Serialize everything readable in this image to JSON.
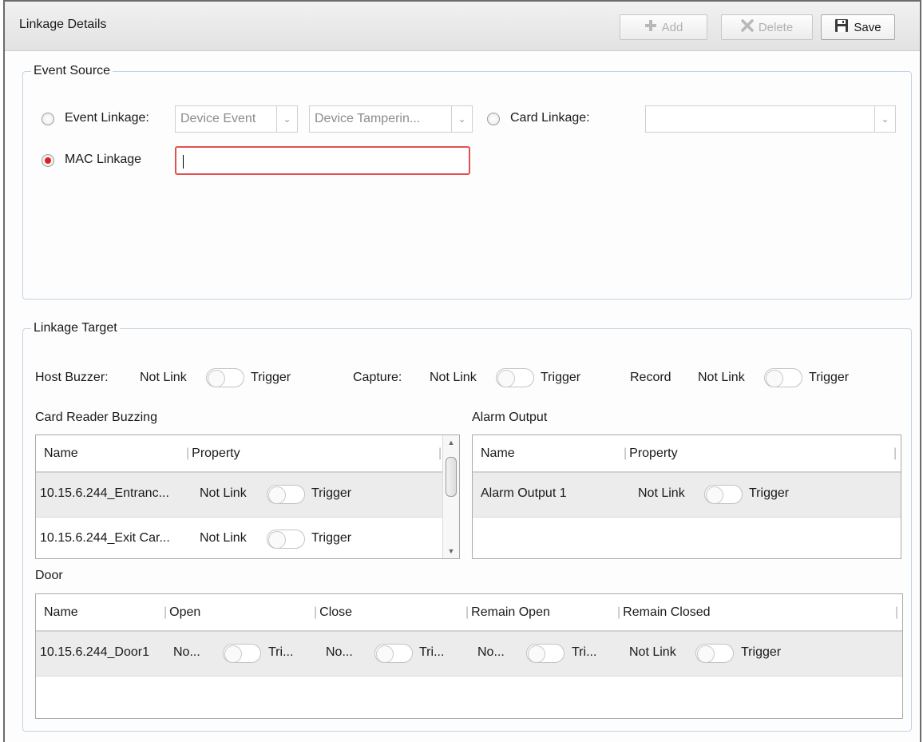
{
  "header": {
    "title": "Linkage Details",
    "add_label": "Add",
    "delete_label": "Delete",
    "save_label": "Save"
  },
  "event_source": {
    "legend": "Event Source",
    "event_linkage": {
      "label": "Event Linkage:",
      "selected": false,
      "category_value": "Device Event",
      "event_value": "Device Tamperin..."
    },
    "card_linkage": {
      "label": "Card Linkage:",
      "selected": false,
      "value": ""
    },
    "mac_linkage": {
      "label": "MAC Linkage",
      "selected": true,
      "value": ""
    }
  },
  "linkage_target": {
    "legend": "Linkage Target",
    "not_link": "Not Link",
    "trigger": "Trigger",
    "host_buzzer_label": "Host Buzzer:",
    "capture_label": "Capture:",
    "record_label": "Record",
    "card_reader": {
      "title": "Card Reader Buzzing",
      "columns": [
        "Name",
        "Property"
      ],
      "rows": [
        {
          "name": "10.15.6.244_Entranc...",
          "not_link": "Not Link",
          "trigger": "Trigger"
        },
        {
          "name": "10.15.6.244_Exit Car...",
          "not_link": "Not Link",
          "trigger": "Trigger"
        }
      ]
    },
    "alarm_output": {
      "title": "Alarm Output",
      "columns": [
        "Name",
        "Property"
      ],
      "rows": [
        {
          "name": "Alarm Output 1",
          "not_link": "Not Link",
          "trigger": "Trigger"
        }
      ]
    },
    "door": {
      "title": "Door",
      "columns": [
        "Name",
        "Open",
        "Close",
        "Remain Open",
        "Remain Closed"
      ],
      "rows": [
        {
          "name": "10.15.6.244_Door1",
          "open_not_link": "No...",
          "open_trigger": "Tri...",
          "close_not_link": "No...",
          "close_trigger": "Tri...",
          "remain_open_not_link": "No...",
          "remain_open_trigger": "Tri...",
          "remain_closed_not_link": "Not Link",
          "remain_closed_trigger": "Trigger"
        }
      ]
    }
  },
  "colors": {
    "accent_red": "#e02020",
    "input_error_border": "#e35050",
    "selected_row": "#ececec"
  }
}
